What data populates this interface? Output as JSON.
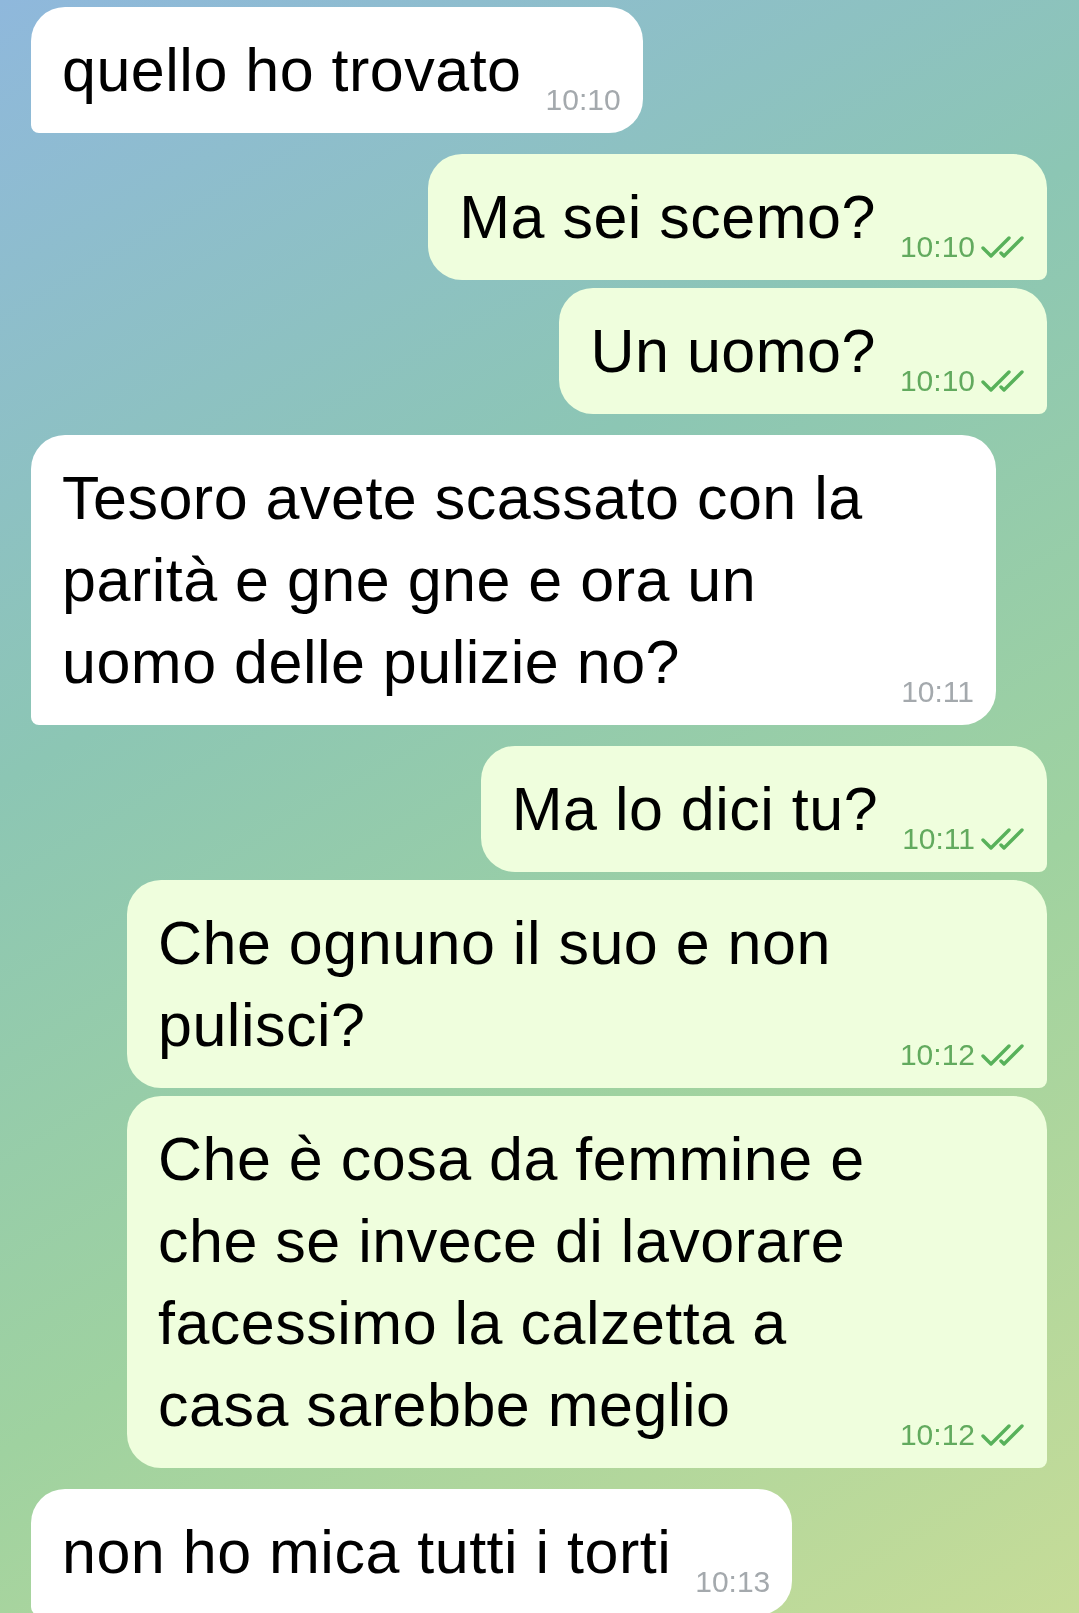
{
  "messages": [
    {
      "outgoing": false,
      "text": "quello ho trovato",
      "time": "10:10"
    },
    {
      "outgoing": true,
      "text": "Ma sei scemo?",
      "time": "10:10",
      "read": true
    },
    {
      "outgoing": true,
      "text": "Un uomo?",
      "time": "10:10",
      "read": true
    },
    {
      "outgoing": false,
      "text": "Tesoro avete scassato con la parità e gne gne e ora un uomo delle pulizie no?",
      "time": "10:11"
    },
    {
      "outgoing": true,
      "text": "Ma lo dici tu?",
      "time": "10:11",
      "read": true
    },
    {
      "outgoing": true,
      "text": "Che ognuno il suo e non pulisci?",
      "time": "10:12",
      "read": true
    },
    {
      "outgoing": true,
      "text": "Che è cosa da femmine e che se invece di lavorare facessimo la calzetta a casa sarebbe meglio",
      "time": "10:12",
      "read": true
    },
    {
      "outgoing": false,
      "text": "non ho mica tutti i torti",
      "time": "10:13"
    }
  ]
}
